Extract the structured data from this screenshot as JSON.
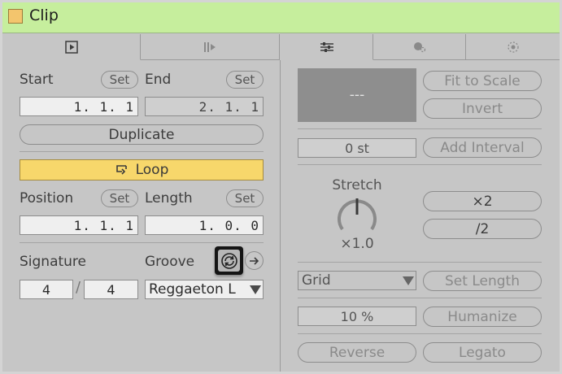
{
  "window": {
    "title": "Clip"
  },
  "colors": {
    "title_bar": "#c6ee9d",
    "clip_color": "#f3c56d",
    "loop_active": "#f7d76b",
    "panel": "#c6c6c6"
  },
  "tabs": [
    {
      "icon": "play-clip-icon",
      "active": true
    },
    {
      "icon": "envelope-icon",
      "active": false
    },
    {
      "icon": "audio-settings-icon",
      "active": true
    },
    {
      "icon": "pitch-icon",
      "active": false
    },
    {
      "icon": "groove-settings-icon",
      "active": false
    }
  ],
  "left": {
    "start": {
      "label": "Start",
      "set_label": "Set",
      "value": "1. 1. 1"
    },
    "end": {
      "label": "End",
      "set_label": "Set",
      "value": "2. 1. 1"
    },
    "duplicate_label": "Duplicate",
    "loop_label": "Loop",
    "position": {
      "label": "Position",
      "set_label": "Set",
      "value": "1. 1. 1"
    },
    "length": {
      "label": "Length",
      "set_label": "Set",
      "value": "1. 0. 0"
    },
    "signature": {
      "label": "Signature",
      "numerator": "4",
      "denominator": "4",
      "separator": "/"
    },
    "groove": {
      "label": "Groove",
      "value": "Reggaeton L"
    }
  },
  "right": {
    "sample_display": "---",
    "fit_to_scale_label": "Fit to Scale",
    "invert_label": "Invert",
    "transpose_value": "0 st",
    "add_interval_label": "Add Interval",
    "stretch": {
      "label": "Stretch",
      "value": "×1.0",
      "double_label": "×2",
      "half_label": "/2"
    },
    "grid": {
      "value": "Grid"
    },
    "set_length_label": "Set Length",
    "humanize": {
      "value": "10 %",
      "label": "Humanize"
    },
    "reverse_label": "Reverse",
    "legato_label": "Legato"
  }
}
